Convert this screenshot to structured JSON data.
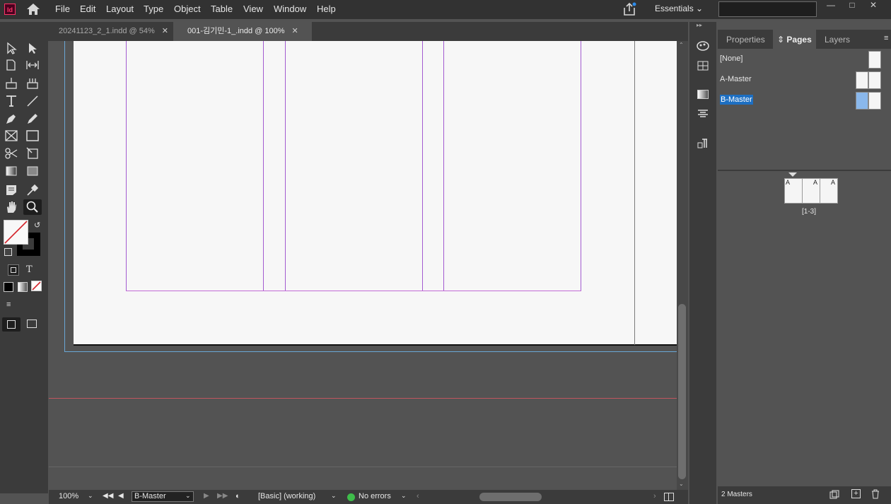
{
  "menu": {
    "items": [
      "File",
      "Edit",
      "Layout",
      "Type",
      "Object",
      "Table",
      "View",
      "Window",
      "Help"
    ],
    "app_logo": "Id",
    "workspace": "Essentials"
  },
  "tabs": [
    {
      "label": "20241123_2_1.indd @ 54%",
      "active": false
    },
    {
      "label": "001-김기민-1_.indd @ 100%",
      "active": true
    }
  ],
  "tools": [
    "selection-icon",
    "direct-selection-icon",
    "page-tool-icon",
    "gap-tool-icon",
    "content-collector-icon",
    "content-placer-icon",
    "type-tool-icon",
    "line-tool-icon",
    "pen-tool-icon",
    "pencil-tool-icon",
    "rectangle-frame-icon",
    "rectangle-tool-icon",
    "scissors-icon",
    "free-transform-icon",
    "gradient-swatch-icon",
    "gradient-feather-icon",
    "note-tool-icon",
    "eyedropper-icon",
    "hand-tool-icon",
    "zoom-tool-icon"
  ],
  "status": {
    "zoom": "100%",
    "page": "B-Master",
    "style": "[Basic] (working)",
    "preflight": "No errors"
  },
  "panel": {
    "tabs": [
      "Properties",
      "Pages",
      "Layers"
    ],
    "active_tab": "Pages",
    "masters": [
      "[None]",
      "A-Master",
      "B-Master"
    ],
    "selected_master": "B-Master",
    "spread_letters": [
      "A",
      "A",
      "A"
    ],
    "spread_label": "[1-3]",
    "footer": "2 Masters"
  },
  "colors": {
    "accent_selection": "#1d6fc2",
    "guide_purple": "#a35bd0",
    "status_ok": "#3ebd4a"
  }
}
